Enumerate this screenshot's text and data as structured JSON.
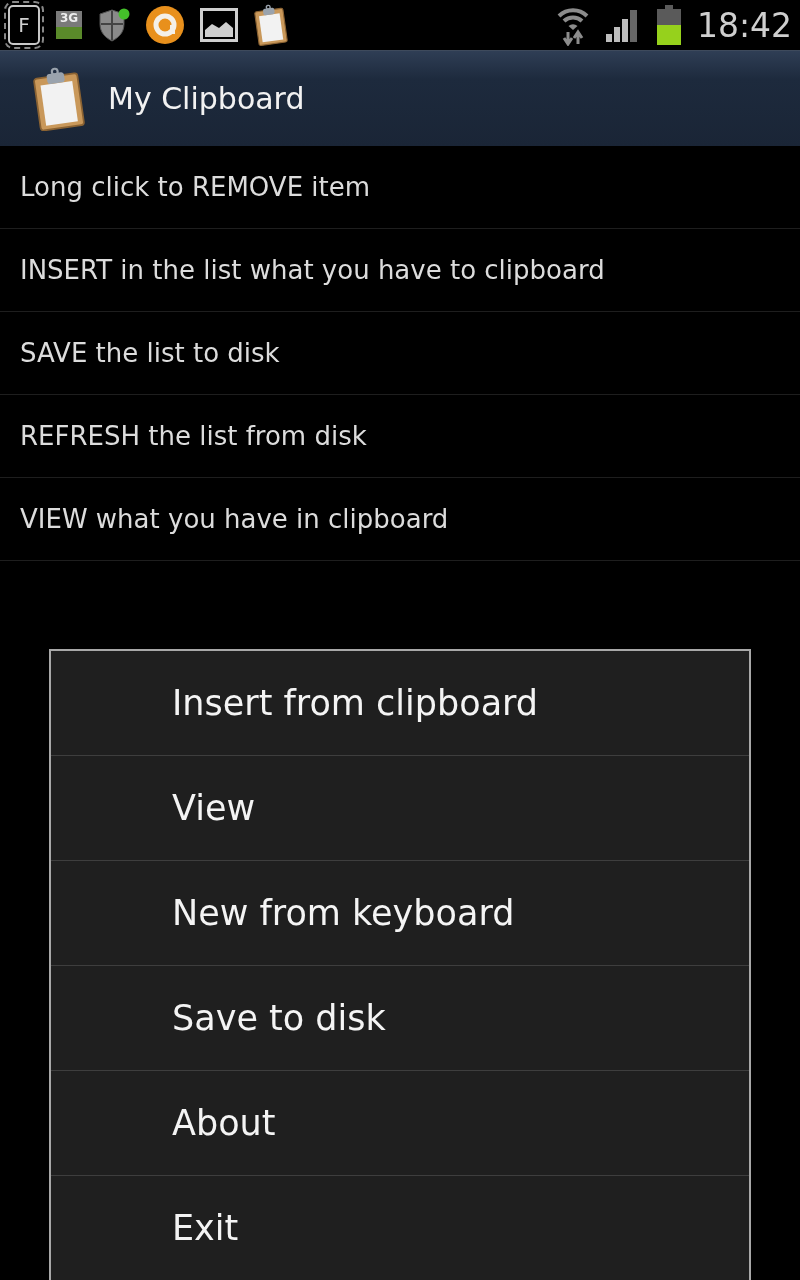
{
  "status_bar": {
    "screen_mode_letter": "F",
    "network_type": "3G",
    "time": "18:42"
  },
  "action_bar": {
    "title": "My Clipboard"
  },
  "list": {
    "items": [
      "Long click to REMOVE item",
      "INSERT in the list what you have to clipboard",
      "SAVE the list to disk",
      "REFRESH the list from disk",
      "VIEW what you have in clipboard"
    ]
  },
  "context_menu": {
    "items": [
      "Insert from clipboard",
      "View",
      "New from keyboard",
      "Save to disk",
      "About",
      "Exit"
    ]
  }
}
